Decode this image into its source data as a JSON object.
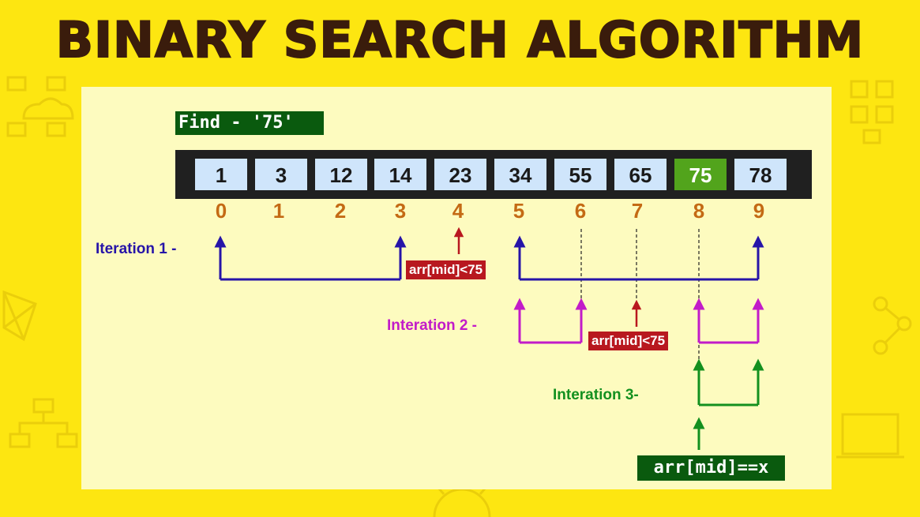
{
  "title": "BINARY SEARCH ALGORITHM",
  "find_label": "Find - '75'",
  "array": {
    "values": [
      "1",
      "3",
      "12",
      "14",
      "23",
      "34",
      "55",
      "65",
      "75",
      "78"
    ],
    "indices": [
      "0",
      "1",
      "2",
      "3",
      "4",
      "5",
      "6",
      "7",
      "8",
      "9"
    ],
    "found_index": 8
  },
  "iterations": [
    {
      "label": "Iteration 1 -",
      "color": "#2614a8",
      "left_range": [
        0,
        3
      ],
      "right_range": [
        5,
        9
      ],
      "mid": 4,
      "mid_label": "arr[mid]<75"
    },
    {
      "label": "Interation 2 -",
      "color": "#c21bc9",
      "left_range": [
        5,
        6
      ],
      "right_range": [
        8,
        9
      ],
      "mid": 7,
      "mid_label": "arr[mid]<75"
    },
    {
      "label": "Interation 3-",
      "color": "#13901f",
      "range": [
        8,
        9
      ],
      "mid": 8
    }
  ],
  "result_label": "arr[mid]==x",
  "colors": {
    "background": "#fde611",
    "title": "#3a1c0c",
    "panel": "#fdfbbf",
    "cell": "#cfe5fb",
    "found_cell": "#52a41c",
    "index": "#c46a14",
    "mid_box": "#b8181f",
    "dark_green_box": "#0a5a0e",
    "mid_arrow": "#b8181f"
  }
}
